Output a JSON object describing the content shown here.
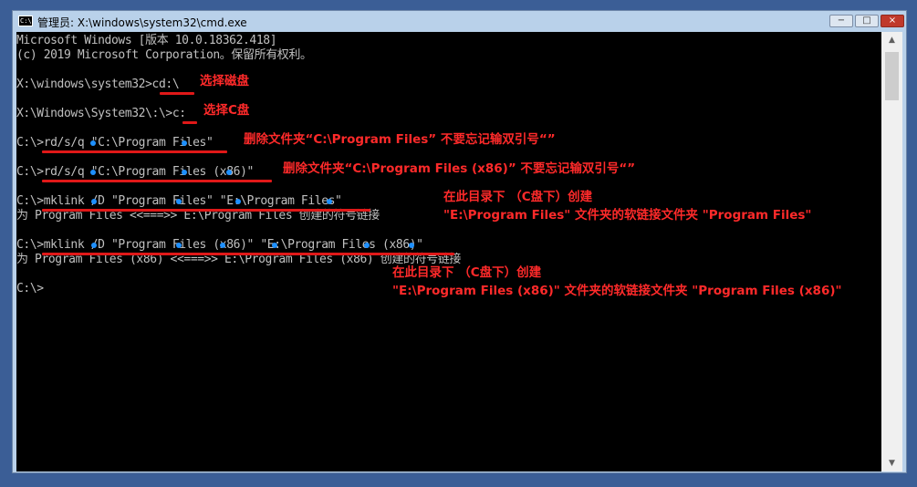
{
  "window": {
    "title": "管理员: X:\\windows\\system32\\cmd.exe",
    "icon": "cmd-icon",
    "icon_text": "C:\\",
    "buttons": {
      "minimize": "−",
      "maximize": "□",
      "close": "×"
    }
  },
  "console": {
    "lines": [
      "Microsoft Windows [版本 10.0.18362.418]",
      "(c) 2019 Microsoft Corporation。保留所有权利。",
      "X:\\windows\\system32>cd:\\",
      "X:\\Windows\\System32\\:\\>c:",
      "C:\\>rd/s/q \"C:\\Program Files\"",
      "C:\\>rd/s/q \"C:\\Program Files (x86)\"",
      "C:\\>mklink /D \"Program Files\" \"E:\\Program Files\"",
      "为 Program Files <<===>> E:\\Program Files 创建的符号链接",
      "C:\\>mklink /D \"Program Files (x86)\" \"E:\\Program Files (x86)\"",
      "为 Program Files (x86) <<===>> E:\\Program Files (x86) 创建的符号链接",
      "C:\\>"
    ]
  },
  "annotations": {
    "select_disk": "选择磁盘",
    "select_c": "选择C盘",
    "delete_pf": "删除文件夹“C:\\Program Files” 不要忘记输双引号“”",
    "delete_pf86": "删除文件夹“C:\\Program Files (x86)” 不要忘记输双引号“”",
    "mklink1_line1": "在此目录下 （C盘下）创建",
    "mklink1_line2": "\"E:\\Program Files\" 文件夹的软链接文件夹 \"Program Files\"",
    "mklink2_line1": "在此目录下 （C盘下）创建",
    "mklink2_line2": "\"E:\\Program Files (x86)\" 文件夹的软链接文件夹 \"Program Files (x86)\""
  },
  "colors": {
    "annotation": "#ff2a2a",
    "underline": "#e01818",
    "space_marker": "#1e90ff",
    "console_text": "#c0c0c0",
    "console_bg": "#000000"
  }
}
